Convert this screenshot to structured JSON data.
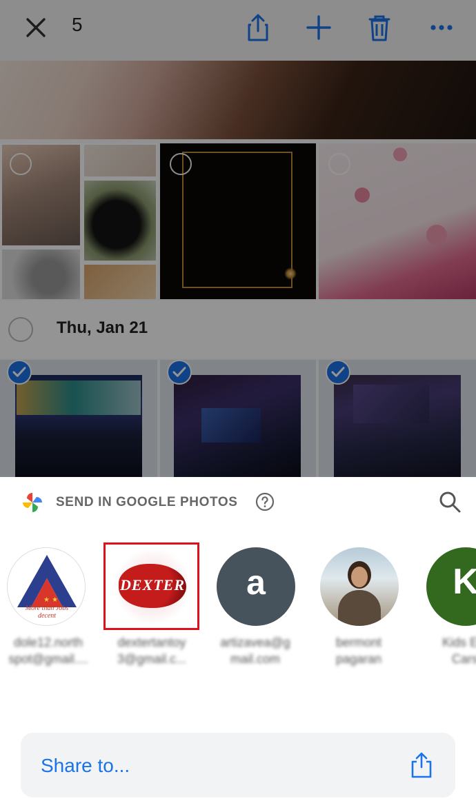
{
  "topbar": {
    "selected_count": "5",
    "icons": [
      "close-icon",
      "share-icon",
      "add-icon",
      "trash-icon",
      "more-icon"
    ],
    "accent": "#1a73e8"
  },
  "photos": {
    "date_label": "Thu, Jan 21",
    "selected_tiles": 3,
    "check_color": "#1a73e8"
  },
  "sheet": {
    "title": "SEND IN GOOGLE PHOTOS",
    "contacts": [
      {
        "name": "dole12.north\nspot@gmail....",
        "avatar_text": "More than Jobs\ndecent"
      },
      {
        "name": "dextertantoy\n3@gmail.c...",
        "avatar_text": "DEXTER"
      },
      {
        "name": "artizavea@g\nmail.com",
        "avatar_text": "a"
      },
      {
        "name": "bermont\npagaran",
        "avatar_text": ""
      },
      {
        "name": "Kids Ele\nCars",
        "avatar_text": "K"
      }
    ],
    "share_label": "Share to...",
    "highlight_color": "#e0101a"
  }
}
